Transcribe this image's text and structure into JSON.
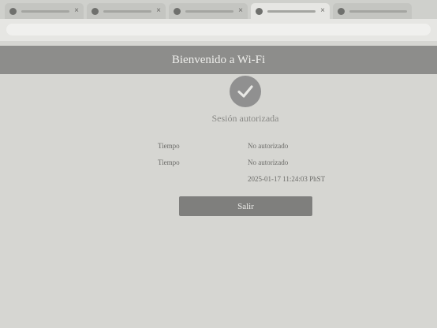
{
  "browser": {
    "tabs": [
      {
        "icon": "tab-favicon-icon"
      },
      {
        "icon": "tab-favicon-icon"
      },
      {
        "icon": "tab-favicon-icon"
      },
      {
        "icon": "tab-favicon-icon"
      },
      {
        "icon": "tab-favicon-icon"
      }
    ],
    "close_glyph": "×"
  },
  "header": {
    "title": "Bienvenido a Wi-Fi"
  },
  "status": {
    "icon": "checkmark-icon",
    "text": "Sesión autorizada"
  },
  "details": [
    {
      "label": "Tiempo",
      "value": "No autorizado"
    },
    {
      "label": "Tiempo",
      "value": "No autorizado"
    },
    {
      "label": "",
      "value": "2025-01-17 11:24:03 PhST"
    }
  ],
  "action": {
    "label": "Salir"
  },
  "colors": {
    "header": "#8d8d8b",
    "button": "#7f7f7d",
    "check_circle": "#909090"
  }
}
